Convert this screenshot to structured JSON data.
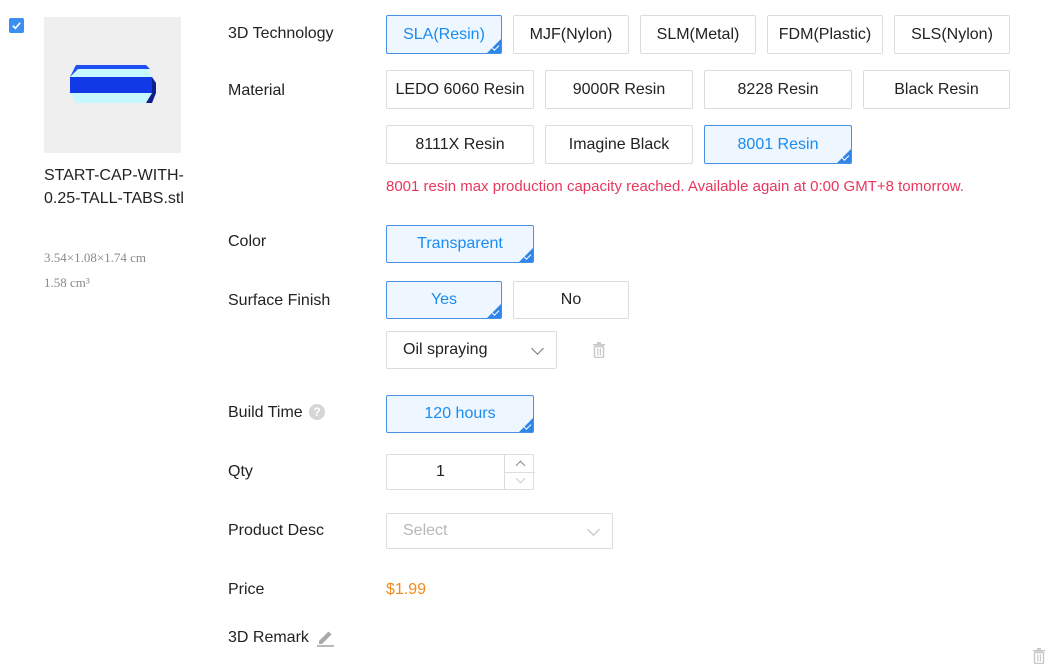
{
  "item": {
    "checked": true,
    "filename": "START-CAP-WITH-0.25-TALL-TABS.stl",
    "dimensions": "3.54×1.08×1.74 cm",
    "volume": "1.58 cm³"
  },
  "technology": {
    "label": "3D Technology",
    "options": [
      "SLA(Resin)",
      "MJF(Nylon)",
      "SLM(Metal)",
      "FDM(Plastic)",
      "SLS(Nylon)"
    ],
    "selected": "SLA(Resin)"
  },
  "material": {
    "label": "Material",
    "options": [
      "LEDO 6060 Resin",
      "9000R Resin",
      "8228 Resin",
      "Black Resin",
      "8111X Resin",
      "Imagine Black",
      "8001 Resin"
    ],
    "selected": "8001 Resin",
    "warning": "8001 resin max production capacity reached. Available again at 0:00 GMT+8 tomorrow."
  },
  "color": {
    "label": "Color",
    "options": [
      "Transparent"
    ],
    "selected": "Transparent"
  },
  "surface_finish": {
    "label": "Surface Finish",
    "options": [
      "Yes",
      "No"
    ],
    "selected": "Yes",
    "method_value": "Oil spraying"
  },
  "build_time": {
    "label": "Build Time",
    "help_glyph": "?",
    "options": [
      "120 hours"
    ],
    "selected": "120 hours"
  },
  "qty": {
    "label": "Qty",
    "value": "1"
  },
  "product_desc": {
    "label": "Product Desc",
    "placeholder": "Select"
  },
  "price": {
    "label": "Price",
    "value": "$1.99"
  },
  "remark": {
    "label": "3D Remark"
  },
  "colors": {
    "accent": "#1a8cf0",
    "warning": "#e8365d",
    "price": "#f08a1c"
  }
}
